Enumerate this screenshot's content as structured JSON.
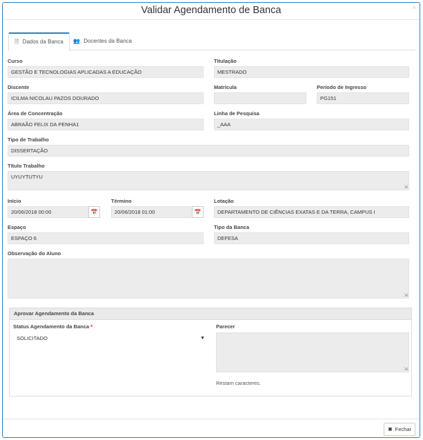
{
  "modal": {
    "title": "Validar Agendamento de Banca",
    "close_glyph": "×"
  },
  "tabs": [
    {
      "label": "Dados da Banca",
      "icon": "document-icon",
      "active": true
    },
    {
      "label": "Docentes da Banca",
      "icon": "users-icon",
      "active": false
    }
  ],
  "fields": {
    "curso": {
      "label": "Curso",
      "value": "GESTÃO E TECNOLOGIAS APLICADAS A EDUCAÇÃO"
    },
    "titulacao": {
      "label": "Titulação",
      "value": "MESTRADO"
    },
    "discente": {
      "label": "Discente",
      "value": "ICILMA NICOLAU PAZOS DOURADO"
    },
    "matricula": {
      "label": "Matrícula",
      "value": ""
    },
    "periodo": {
      "label": "Período de Ingresso",
      "value": "PG151"
    },
    "area": {
      "label": "Área de Concentração",
      "value": "ABRAÃO FELIX DA PENHA1"
    },
    "linha": {
      "label": "Linha de Pesquisa",
      "value": "_AAA"
    },
    "tipo_trabalho": {
      "label": "Tipo de Trabalho",
      "value": "DISSERTAÇÃO"
    },
    "titulo": {
      "label": "Título Trabalho",
      "value": "UYUYTUTYU"
    },
    "inicio": {
      "label": "Início",
      "value": "20/06/2018 00:00"
    },
    "termino": {
      "label": "Término",
      "value": "20/06/2018 01:00"
    },
    "lotacao": {
      "label": "Lotação",
      "value": "DEPARTAMENTO DE CIÊNCIAS EXATAS E DA TERRA, CAMPUS I"
    },
    "espaco": {
      "label": "Espaço",
      "value": "ESPAÇO 6"
    },
    "tipo_banca": {
      "label": "Tipo da Banca",
      "value": "DEFESA"
    },
    "observacao": {
      "label": "Observação do Aluno",
      "value": ""
    }
  },
  "approval": {
    "title": "Aprovar Agendamento da Banca",
    "status_label": "Status Agendamento da Banca",
    "required_mark": "*",
    "status_value": "SOLICITADO",
    "parecer_label": "Parecer",
    "parecer_value": "",
    "remaining_text": "Restam caracteres."
  },
  "footer": {
    "close_label": "Fechar"
  }
}
